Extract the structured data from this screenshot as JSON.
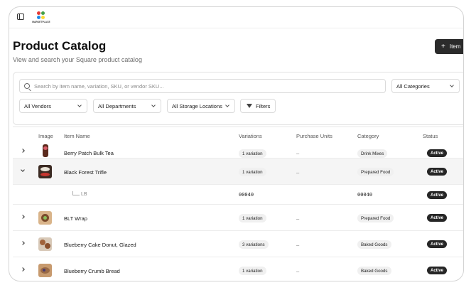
{
  "app": {
    "logo_text": "MARKETPLACE"
  },
  "header": {
    "title": "Product Catalog",
    "subtitle": "View and search your Square product catalog",
    "add_button_label": "Item"
  },
  "filters": {
    "search_placeholder": "Search by item name, variation, SKU, or vendor SKU...",
    "categories_value": "All Categories",
    "vendors_value": "All Vendors",
    "departments_value": "All Departments",
    "storage_value": "All Storage Locations",
    "filters_label": "Filters"
  },
  "table": {
    "columns": [
      "Image",
      "Item Name",
      "Variations",
      "Purchase Units",
      "Category",
      "Status"
    ],
    "rows": [
      {
        "name": "Berry Patch Bulk Tea",
        "variations": "1 variation",
        "units": "–",
        "category": "Drink Mixes",
        "status": "Active"
      },
      {
        "name": "Black Forest Trifle",
        "variations": "1 variation",
        "units": "–",
        "category": "Prepared Food",
        "status": "Active"
      },
      {
        "name": "BLT Wrap",
        "variations": "1 variation",
        "units": "–",
        "category": "Prepared Food",
        "status": "Active"
      },
      {
        "name": "Blueberry Cake Donut, Glazed",
        "variations": "3 variations",
        "units": "–",
        "category": "Baked Goods",
        "status": "Active"
      },
      {
        "name": "Blueberry Crumb Bread",
        "variations": "1 variation",
        "units": "–",
        "category": "Baked Goods",
        "status": "Active"
      }
    ],
    "subrow": {
      "label": "LB",
      "sku": "00040",
      "category_code": "00040",
      "status": "Active"
    }
  },
  "colors": {
    "accent_dark": "#2b2b2b",
    "pill_bg": "#f0f0f0",
    "logo_colors": [
      "#e53935",
      "#43a047",
      "#1e88e5",
      "#fdd835"
    ]
  }
}
